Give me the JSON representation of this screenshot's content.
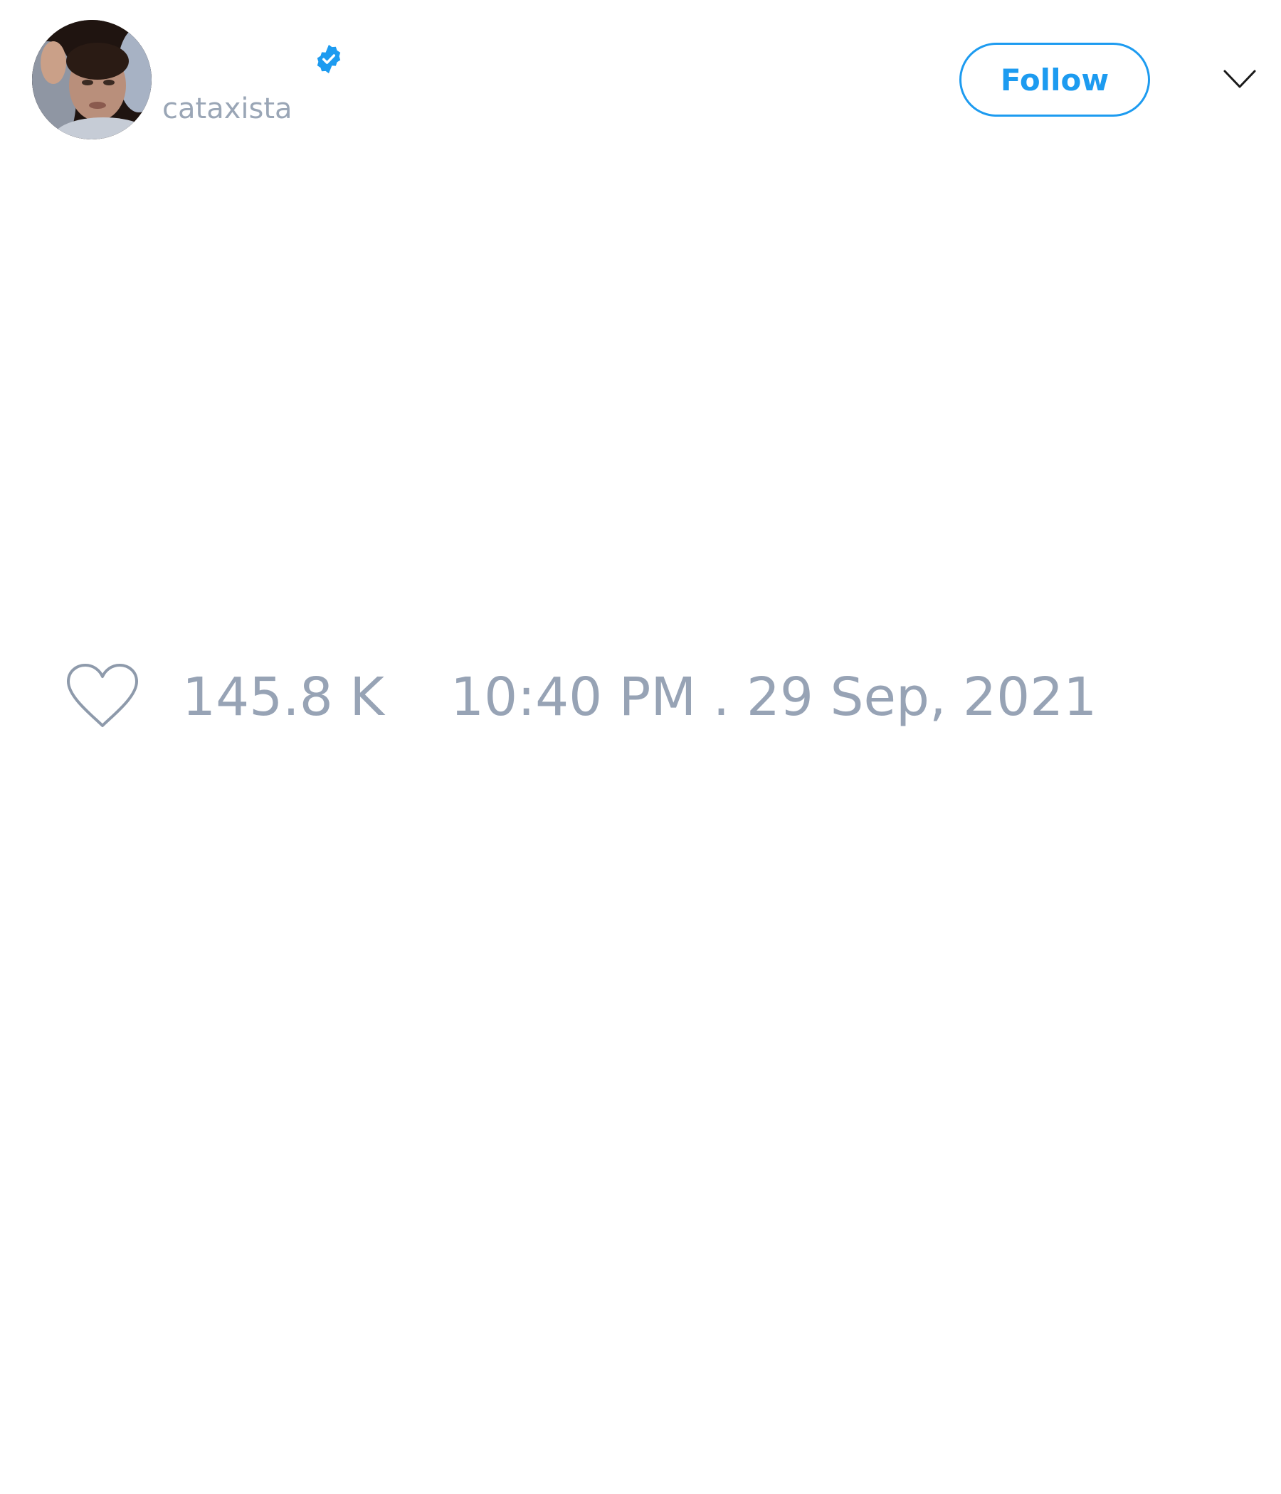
{
  "author": {
    "handle": "cataxista",
    "avatar_icon": "profile-photo",
    "verified_icon": "verified-badge-icon"
  },
  "header": {
    "follow_label": "Follow",
    "menu_icon": "chevron-down-icon"
  },
  "tweet": {
    "like_icon": "heart-icon",
    "like_count": "145.8 K",
    "timestamp": "10:40 PM . 29 Sep, 2021"
  },
  "colors": {
    "accent": "#1d9bf0",
    "muted_text": "#97a3b5"
  }
}
